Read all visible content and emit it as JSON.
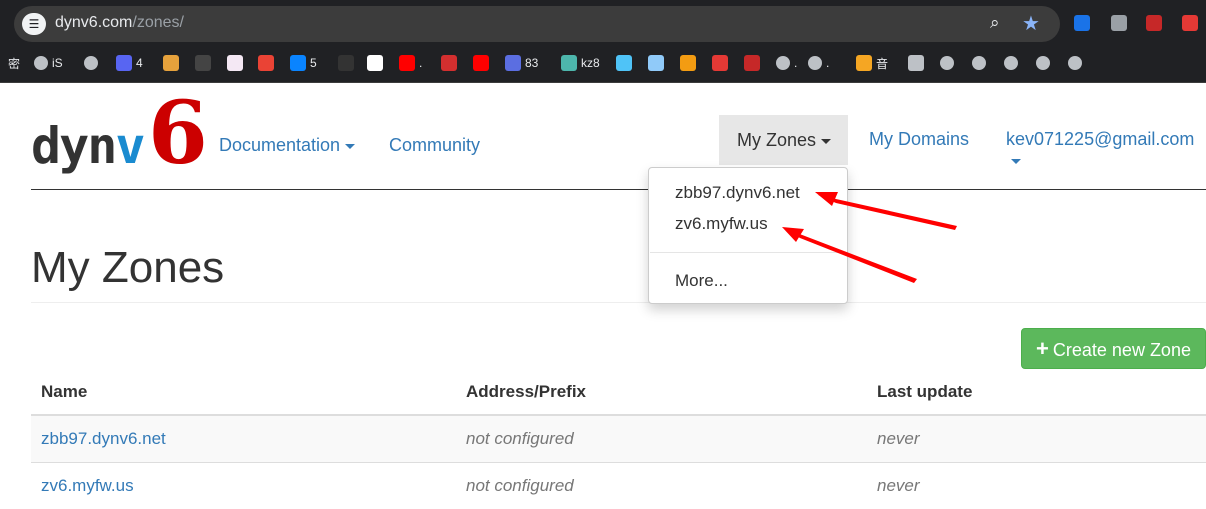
{
  "browser": {
    "url_host": "dynv6.com",
    "url_path": "/zones/",
    "site_info_glyph": "☰",
    "zoom_glyph": "⌕",
    "star_glyph": "★",
    "extension_colors": [
      "#1a73e8",
      "#9aa0a6",
      "#c62828",
      "#e53935"
    ]
  },
  "bookmarks": [
    {
      "label": "密",
      "icon": "text-icon",
      "color": ""
    },
    {
      "label": "iS",
      "icon": "globe-icon",
      "color": "#bdc1c6"
    },
    {
      "label": "",
      "icon": "globe-icon",
      "color": "#bdc1c6"
    },
    {
      "label": "4",
      "icon": "discord-icon",
      "color": "#5865f2"
    },
    {
      "label": "",
      "icon": "app-icon",
      "color": "#e6a23c"
    },
    {
      "label": "",
      "icon": "app-icon",
      "color": "#444"
    },
    {
      "label": "",
      "icon": "app-icon",
      "color": "#f4e8f4"
    },
    {
      "label": "",
      "icon": "gmail-icon",
      "color": "#ea4335"
    },
    {
      "label": "5",
      "icon": "onedrive-icon",
      "color": "#0a84ff"
    },
    {
      "label": "",
      "icon": "github-icon",
      "color": "#333"
    },
    {
      "label": "",
      "icon": "google-icon",
      "color": "#ffffff"
    },
    {
      "label": ".",
      "icon": "youtube-icon",
      "color": "#ff0000"
    },
    {
      "label": "",
      "icon": "app-icon",
      "color": "#d32f2f"
    },
    {
      "label": "",
      "icon": "youtube-icon",
      "color": "#ff0000"
    },
    {
      "label": "83",
      "icon": "app-icon",
      "color": "#5b6ee1"
    },
    {
      "label": "kz8",
      "icon": "app-icon",
      "color": "#4db6ac"
    },
    {
      "label": "",
      "icon": "app-icon",
      "color": "#4fc3f7"
    },
    {
      "label": "",
      "icon": "app-icon",
      "color": "#90caf9"
    },
    {
      "label": "",
      "icon": "app-icon",
      "color": "#f39c12"
    },
    {
      "label": "",
      "icon": "app-icon",
      "color": "#e53935"
    },
    {
      "label": "",
      "icon": "app-icon",
      "color": "#c62828"
    },
    {
      "label": ".",
      "icon": "globe-icon",
      "color": "#bdc1c6"
    },
    {
      "label": ".",
      "icon": "globe-icon",
      "color": "#bdc1c6"
    },
    {
      "label": "音",
      "icon": "app-icon",
      "color": "#f5a623"
    },
    {
      "label": "",
      "icon": "gear-icon",
      "color": "#bdc1c6"
    },
    {
      "label": "",
      "icon": "globe-icon",
      "color": "#bdc1c6"
    },
    {
      "label": "",
      "icon": "globe-icon",
      "color": "#bdc1c6"
    },
    {
      "label": "",
      "icon": "globe-icon",
      "color": "#bdc1c6"
    },
    {
      "label": "",
      "icon": "globe-icon",
      "color": "#bdc1c6"
    },
    {
      "label": "",
      "icon": "globe-icon",
      "color": "#bdc1c6"
    }
  ],
  "logo": {
    "part1": "dyn",
    "part2": "v",
    "part3": "6"
  },
  "nav": {
    "documentation": "Documentation",
    "community": "Community",
    "my_zones": "My Zones",
    "my_domains": "My Domains",
    "account": "kev071225@gmail.com"
  },
  "dropdown": {
    "items": [
      "zbb97.dynv6.net",
      "zv6.myfw.us"
    ],
    "more": "More..."
  },
  "page": {
    "title": "My Zones",
    "create_button": "Create new Zone",
    "plus_glyph": "+"
  },
  "table": {
    "headers": [
      "Name",
      "Address/Prefix",
      "Last update"
    ],
    "rows": [
      {
        "name": "zbb97.dynv6.net",
        "address": "not configured",
        "updated": "never"
      },
      {
        "name": "zv6.myfw.us",
        "address": "not configured",
        "updated": "never"
      }
    ]
  },
  "colors": {
    "link": "#337ab7",
    "success": "#5cb85c",
    "logo_red": "#cc0000",
    "logo_blue": "#1a8bd0",
    "annotation_arrow": "#ff0000"
  }
}
